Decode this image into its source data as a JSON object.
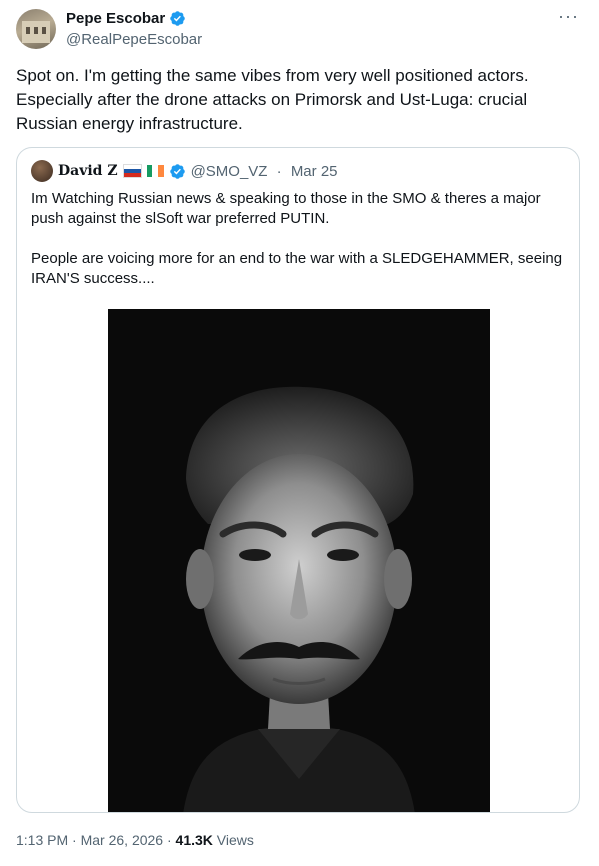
{
  "author": {
    "display_name": "Pepe Escobar",
    "handle": "@RealPepeEscobar",
    "avatar_icon": "profile-photo-building",
    "verified_icon": "verified-badge-icon"
  },
  "more_icon": "···",
  "tweet": {
    "text": "Spot on. I'm getting the same vibes from very well positioned actors. Especially after the drone attacks on Primorsk and Ust-Luga: crucial Russian energy infrastructure."
  },
  "quote": {
    "display_name": "David Z",
    "flags": [
      "russia-flag-icon",
      "ireland-flag-icon"
    ],
    "handle": "@SMO_VZ",
    "date": "Mar 25",
    "meta_sep": " · ",
    "paragraph_1": "Im Watching Russian news & speaking to those in the SMO & theres a major push against the slSoft war preferred PUTIN.",
    "paragraph_2": "People are voicing more for an end to the war with a SLEDGEHAMMER, seeing IRAN'S success....",
    "image_icon": "black-and-white-portrait-image"
  },
  "footer": {
    "time": "1:13 PM",
    "sep": " · ",
    "date": "Mar 26, 2026",
    "views_count": "41.3K",
    "views_label": " Views"
  },
  "colors": {
    "verified_blue": "#1d9bf0",
    "secondary_text": "#536471",
    "border": "#cfd9de"
  }
}
